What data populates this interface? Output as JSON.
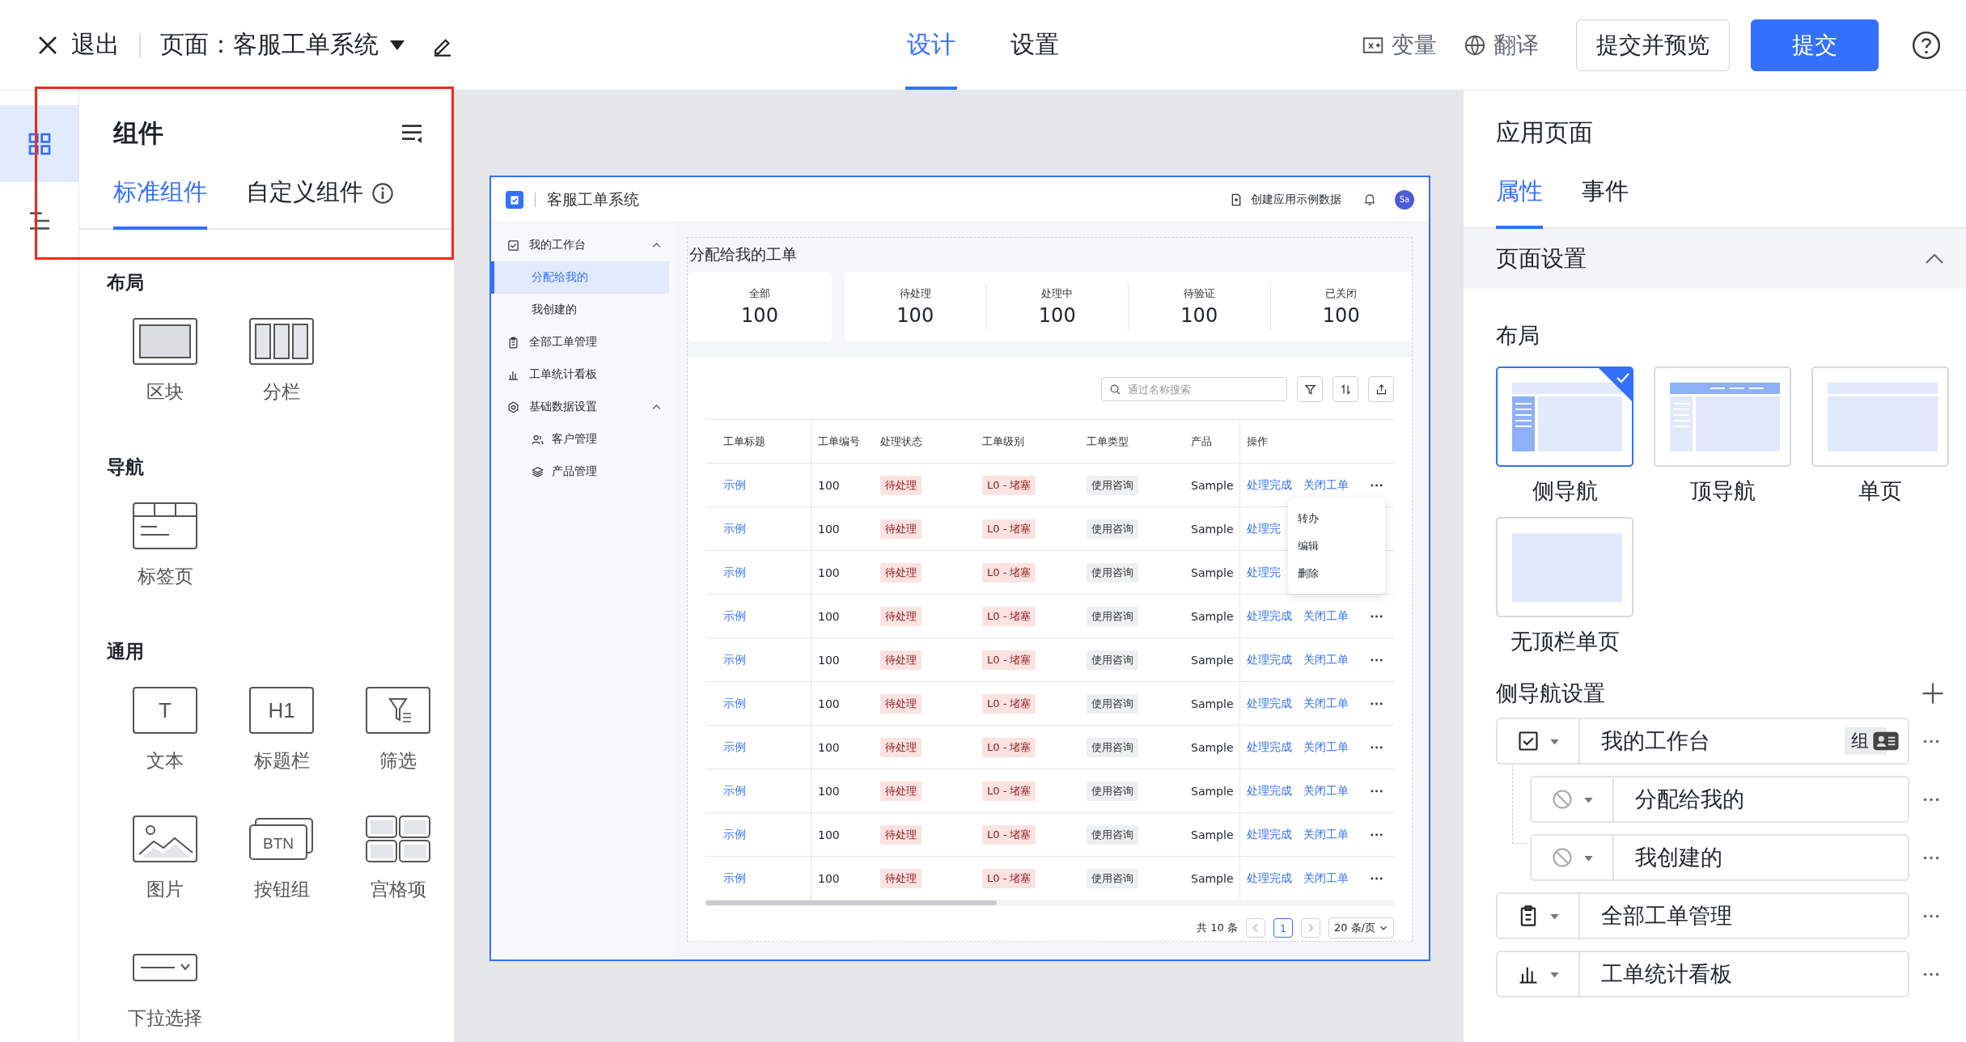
{
  "topbar": {
    "exit": "退出",
    "page_label": "页面：客服工单系统",
    "tabs": [
      {
        "label": "设计",
        "selected": true
      },
      {
        "label": "设置",
        "selected": false
      }
    ],
    "actions": [
      {
        "label": "变量",
        "kind": "variable"
      },
      {
        "label": "翻译",
        "kind": "translate"
      }
    ],
    "buttons": [
      {
        "label": "提交并预览",
        "kind": "secondary"
      },
      {
        "label": "提交",
        "kind": "primary"
      }
    ]
  },
  "rail": [
    {
      "kind": "components",
      "selected": true
    },
    {
      "kind": "outline",
      "selected": false
    }
  ],
  "components_panel": {
    "title": "组件",
    "tabs": [
      {
        "label": "标准组件",
        "selected": true
      },
      {
        "label": "自定义组件",
        "selected": false
      }
    ],
    "groups": [
      {
        "title": "布局",
        "items": [
          {
            "label": "区块",
            "kind": "block"
          },
          {
            "label": "分栏",
            "kind": "columns"
          }
        ]
      },
      {
        "title": "导航",
        "items": [
          {
            "label": "标签页",
            "kind": "tabs"
          }
        ]
      },
      {
        "title": "通用",
        "items": [
          {
            "label": "文本",
            "kind": "text",
            "glyph": "T"
          },
          {
            "label": "标题栏",
            "kind": "heading",
            "glyph": "H1"
          },
          {
            "label": "筛选",
            "kind": "filter"
          },
          {
            "label": "图片",
            "kind": "image"
          },
          {
            "label": "按钮组",
            "kind": "buttons",
            "glyph": "BTN"
          },
          {
            "label": "宫格项",
            "kind": "grid"
          },
          {
            "label": "下拉选择",
            "kind": "select"
          }
        ]
      }
    ]
  },
  "preview": {
    "app_title": "客服工单系统",
    "create_sample": "创建应用示例数据",
    "avatar": "Sa",
    "nav": [
      {
        "label": "我的工作台",
        "kind": "checkbox",
        "expanded": true,
        "children": [
          {
            "label": "分配给我的",
            "selected": true
          },
          {
            "label": "我创建的",
            "selected": false
          }
        ]
      },
      {
        "label": "全部工单管理",
        "kind": "clipboard"
      },
      {
        "label": "工单统计看板",
        "kind": "chart"
      },
      {
        "label": "基础数据设置",
        "kind": "gear",
        "expanded": true,
        "children": [
          {
            "label": "客户管理",
            "kind": "users",
            "selected": false
          },
          {
            "label": "产品管理",
            "kind": "layers",
            "selected": false
          }
        ]
      }
    ],
    "page_title": "分配给我的工单",
    "stats": [
      {
        "label": "全部",
        "value": "100"
      },
      {
        "label": "待处理",
        "value": "100"
      },
      {
        "label": "处理中",
        "value": "100"
      },
      {
        "label": "待验证",
        "value": "100"
      },
      {
        "label": "已关闭",
        "value": "100"
      }
    ],
    "search_placeholder": "通过名称搜索",
    "columns": [
      "工单标题",
      "工单编号",
      "处理状态",
      "工单级别",
      "工单类型",
      "产品",
      "操作"
    ],
    "rows": [
      {
        "title": "示例",
        "number": "100",
        "status": "待处理",
        "level": "L0 - 堵塞",
        "type": "使用咨询",
        "product": "Sample",
        "actions": [
          "处理完成",
          "关闭工单"
        ]
      },
      {
        "title": "示例",
        "number": "100",
        "status": "待处理",
        "level": "L0 - 堵塞",
        "type": "使用咨询",
        "product": "Sample",
        "actions": [
          "处理完"
        ]
      },
      {
        "title": "示例",
        "number": "100",
        "status": "待处理",
        "level": "L0 - 堵塞",
        "type": "使用咨询",
        "product": "Sample",
        "actions": [
          "处理完"
        ]
      },
      {
        "title": "示例",
        "number": "100",
        "status": "待处理",
        "level": "L0 - 堵塞",
        "type": "使用咨询",
        "product": "Sample",
        "actions": [
          "处理完成",
          "关闭工单"
        ]
      },
      {
        "title": "示例",
        "number": "100",
        "status": "待处理",
        "level": "L0 - 堵塞",
        "type": "使用咨询",
        "product": "Sample",
        "actions": [
          "处理完成",
          "关闭工单"
        ]
      },
      {
        "title": "示例",
        "number": "100",
        "status": "待处理",
        "level": "L0 - 堵塞",
        "type": "使用咨询",
        "product": "Sample",
        "actions": [
          "处理完成",
          "关闭工单"
        ]
      },
      {
        "title": "示例",
        "number": "100",
        "status": "待处理",
        "level": "L0 - 堵塞",
        "type": "使用咨询",
        "product": "Sample",
        "actions": [
          "处理完成",
          "关闭工单"
        ]
      },
      {
        "title": "示例",
        "number": "100",
        "status": "待处理",
        "level": "L0 - 堵塞",
        "type": "使用咨询",
        "product": "Sample",
        "actions": [
          "处理完成",
          "关闭工单"
        ]
      },
      {
        "title": "示例",
        "number": "100",
        "status": "待处理",
        "level": "L0 - 堵塞",
        "type": "使用咨询",
        "product": "Sample",
        "actions": [
          "处理完成",
          "关闭工单"
        ]
      },
      {
        "title": "示例",
        "number": "100",
        "status": "待处理",
        "level": "L0 - 堵塞",
        "type": "使用咨询",
        "product": "Sample",
        "actions": [
          "处理完成",
          "关闭工单"
        ]
      }
    ],
    "menu": [
      "转办",
      "编辑",
      "删除"
    ],
    "pagination": {
      "total": "共 10 条",
      "page": "1",
      "page_size": "20 条/页"
    }
  },
  "properties_panel": {
    "title": "应用页面",
    "tabs": [
      {
        "label": "属性",
        "selected": true
      },
      {
        "label": "事件",
        "selected": false
      }
    ],
    "section": {
      "title": "页面设置",
      "expanded": true
    },
    "layout_label": "布局",
    "layouts": [
      {
        "label": "侧导航",
        "kind": "side",
        "selected": true
      },
      {
        "label": "顶导航",
        "kind": "top",
        "selected": false
      },
      {
        "label": "单页",
        "kind": "single",
        "selected": false
      },
      {
        "label": "无顶栏单页",
        "kind": "bare",
        "selected": false
      }
    ],
    "nav_settings_title": "侧导航设置",
    "nav_items": [
      {
        "label": "我的工作台",
        "kind": "checkbox",
        "tag": "组",
        "children": [
          {
            "label": "分配给我的",
            "kind": "none"
          },
          {
            "label": "我创建的",
            "kind": "none"
          }
        ]
      },
      {
        "label": "全部工单管理",
        "kind": "clipboard"
      },
      {
        "label": "工单统计看板",
        "kind": "chart"
      }
    ]
  }
}
